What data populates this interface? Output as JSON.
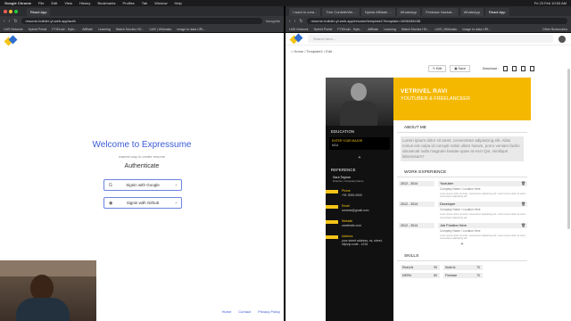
{
  "menubar": {
    "items": [
      "Google Chrome",
      "File",
      "Edit",
      "View",
      "History",
      "Bookmarks",
      "Profiles",
      "Tab",
      "Window",
      "Help"
    ],
    "clock": "Fri 23 Feb 10:53 AM"
  },
  "left_window": {
    "tab": "React App",
    "url": "resume-builder-yt.web.app/auth",
    "incognito": "Incognito",
    "bookmarks": [
      "LMS Network",
      "Hybrid Portal",
      "FYIDroid - Hybr...",
      "Affiliate",
      "Learning",
      "Watch Movies HD...",
      "LMS | Wikinaku",
      "image to data URI..."
    ],
    "welcome": "Welcome to Expressume",
    "subtitle": "easiest way to create resume",
    "auth_heading": "Authenticate",
    "google_btn": "Signin with Google",
    "github_btn": "Signin with Github",
    "footer": [
      "Home",
      "Contact",
      "Privacy Policy"
    ]
  },
  "right_window": {
    "tabs": [
      "I want to crea...",
      "Trim ConfetteWe...",
      "Hybrid Affiliate ...",
      "WhatsApp",
      "Firebase Hackat...",
      "WhatsApp",
      "React App"
    ],
    "url": "resume-builder-yt.web.app/resume/template1?template=1698438438",
    "bookmarks": [
      "LMS Network",
      "Hybrid Portal",
      "FYIDroid - Hybr...",
      "Affiliate",
      "Learning",
      "Watch Movies HD...",
      "LMS | Wikinaku",
      "image to data URI..."
    ],
    "other_bookmarks": "Other Bookmarks",
    "search_placeholder": "Search here...",
    "breadcrumb": [
      "Home",
      "Template1",
      "Edit"
    ],
    "edit_btn": "Edit",
    "save_btn": "Save",
    "download_label": "Download :"
  },
  "resume": {
    "name": "VETRIVEL RAVI",
    "role": "YOUTUBER & FREELANCEER",
    "education_heading": "EDUCATION",
    "edu_major": "ENTER YOUR MAJOR",
    "edu_school": "MCA",
    "reference_heading": "REFERENCE",
    "ref_name": "Sara Taylore",
    "ref_sub": "Director | Company.Name",
    "contact": [
      {
        "label": "Phone",
        "value": "+91 0000-0000"
      },
      {
        "label": "Email",
        "value": "urname@gmail.com"
      },
      {
        "label": "Website",
        "value": "urwebsite.com"
      },
      {
        "label": "Address",
        "value": "your street address, ss, street, city/zip code - 1234"
      }
    ],
    "about_heading": "ABOUT ME",
    "about_text": "Lorem ipsum dolor sit amet, consectetur adipisicing elit. Alias minus est culpa id corrupti nobis ullam harum, porro veniam facilis obcaecati nulla magnam beatae quae at eos! Qui, similique laboriosam?",
    "experience_heading": "WORK EXPERIENCE",
    "experience": [
      {
        "year": "2012 - 2014",
        "title": "Youtuber",
        "company": "Company Name / Location Here",
        "desc": "Lorem ipsum dolor sit amet, consectetur adipisicing elit. Lorem ipsum dolor sit amet, consectetur adipisicing elit."
      },
      {
        "year": "2012 - 2014",
        "title": "Developer",
        "company": "Company Name / Location Here",
        "desc": "Lorem ipsum dolor sit amet, consectetur adipisicing elit. Lorem ipsum dolor sit amet, consectetur adipisicing elit."
      },
      {
        "year": "2012 - 2014",
        "title": "Job Position Here",
        "company": "Company Name / Location Here",
        "desc": "Lorem ipsum dolor sit amet, consectetur adipisicing elit. Lorem ipsum dolor sit amet, consectetur adipisicing elit."
      }
    ],
    "skills_heading": "SKILLS",
    "skills": [
      {
        "name": "ReactJs",
        "value": "90"
      },
      {
        "name": "NodeJs",
        "value": "70"
      },
      {
        "name": "MERN",
        "value": "80"
      },
      {
        "name": "Firebase",
        "value": "70"
      }
    ]
  },
  "colors": {
    "accent_yellow": "#f5b800",
    "brand_blue": "#3a5bd9",
    "sidebar_dark": "#111111"
  }
}
